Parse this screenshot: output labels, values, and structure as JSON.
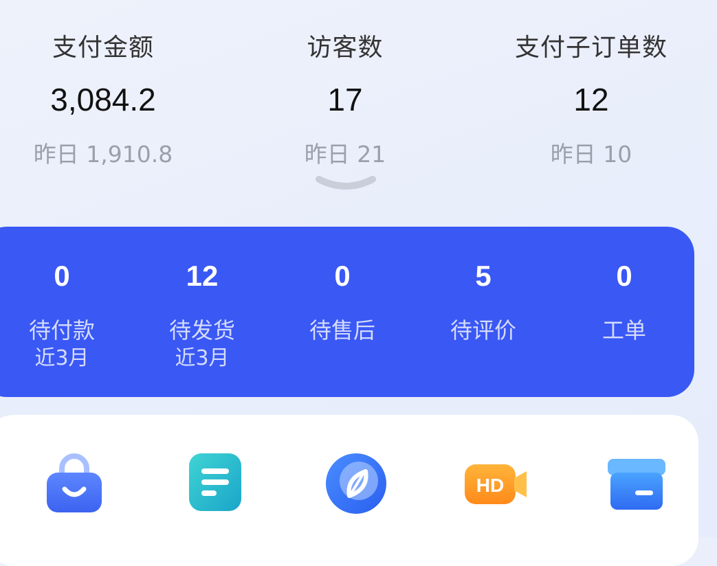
{
  "stats": [
    {
      "label": "支付金额",
      "value": "3,084.2",
      "yesterday": "昨日 1,910.8"
    },
    {
      "label": "访客数",
      "value": "17",
      "yesterday": "昨日 21"
    },
    {
      "label": "支付子订单数",
      "value": "12",
      "yesterday": "昨日 10"
    }
  ],
  "orders": [
    {
      "count": "0",
      "label": "待付款",
      "sub": "近3月"
    },
    {
      "count": "12",
      "label": "待发货",
      "sub": "近3月"
    },
    {
      "count": "0",
      "label": "待售后",
      "sub": ""
    },
    {
      "count": "5",
      "label": "待评价",
      "sub": ""
    },
    {
      "count": "0",
      "label": "工单",
      "sub": ""
    }
  ],
  "tools": [
    {
      "icon": "shopping-bag-icon"
    },
    {
      "icon": "document-list-icon"
    },
    {
      "icon": "compass-icon"
    },
    {
      "icon": "hd-video-icon",
      "text": "HD"
    },
    {
      "icon": "box-icon"
    }
  ],
  "colors": {
    "accent": "#3a58f4",
    "background": "#eef2fb",
    "muted_text": "#9a9fab"
  }
}
